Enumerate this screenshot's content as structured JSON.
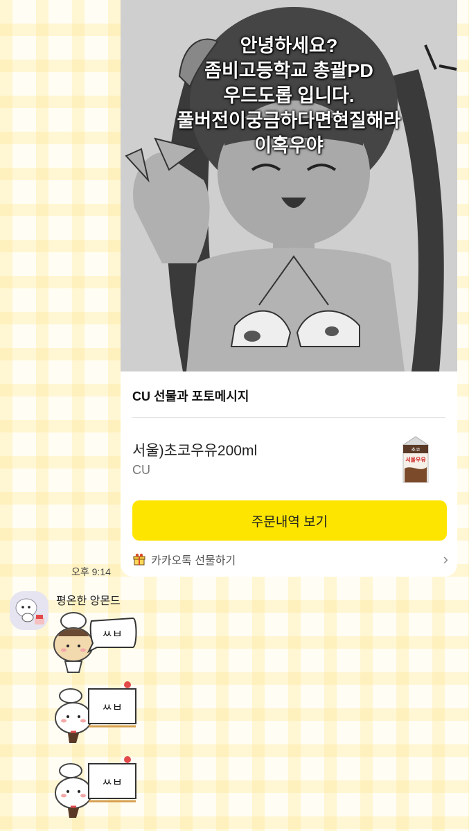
{
  "gift_card": {
    "overlay_lines": [
      "안녕하세요?",
      "좀비고등학교 총괄PD",
      "우드도롭 입니다.",
      "풀버전이궁금하다면현질해라",
      "이혹우야"
    ],
    "title": "CU 선물과 포토메시지",
    "product_name": "서울)초코우유200ml",
    "product_brand": "CU",
    "order_button": "주문내역 보기",
    "footer_label": "카카오톡 선물하기",
    "chevron": "›",
    "milk_carton_text": "서울우유",
    "milk_carton_top": "초코",
    "colors": {
      "button": "#fee500"
    }
  },
  "message": {
    "time": "오후 9:14",
    "sender": "평온한 앙몬드"
  },
  "stickers": [
    {
      "text": "ㅆㅂ"
    },
    {
      "text": "ㅆㅂ"
    },
    {
      "text": "ㅆㅂ"
    }
  ],
  "icons": [
    "gift-icon",
    "chevron-right-icon",
    "avatar",
    "milk-carton"
  ]
}
